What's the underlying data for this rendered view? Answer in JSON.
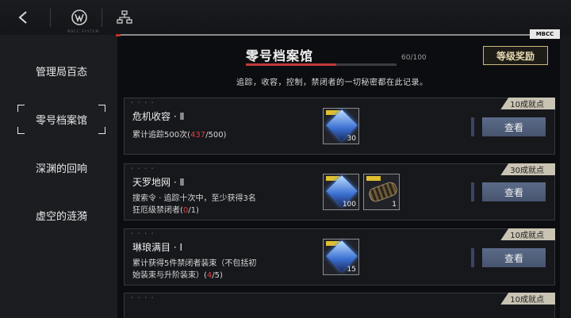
{
  "header": {
    "brand": "MBCC SYSTEM",
    "tag": "MBCC"
  },
  "sidebar": {
    "items": [
      {
        "label": "管理局百态"
      },
      {
        "label": "零号档案馆"
      },
      {
        "label": "深渊的回响"
      },
      {
        "label": "虚空的涟漪"
      }
    ]
  },
  "main": {
    "title": "零号档案馆",
    "progress_text": "60/100",
    "progress": 0.6,
    "subtitle": "追踪，收容，控制，禁闭者的一切秘密都在此记录。",
    "reward_button": "等级奖励",
    "cards": [
      {
        "title": "危机收容 · Ⅱ",
        "desc_a": "累计追踪500次(",
        "desc_cur": "437",
        "desc_b": "/500)",
        "badge": "10成就点",
        "button": "查看",
        "items": [
          {
            "qty": "30"
          }
        ]
      },
      {
        "title": "天罗地网 · Ⅱ",
        "desc_line1": "搜索令 · 追踪十次中，至少获得3名",
        "desc_a": "狂厄级禁闭者(",
        "desc_cur": "0",
        "desc_b": "/1)",
        "badge": "30成就点",
        "button": "查看",
        "items": [
          {
            "qty": "100"
          },
          {
            "qty": "1"
          }
        ]
      },
      {
        "title": "琳琅满目 · Ⅰ",
        "desc_line1": "累计获得5件禁闭者装束（不包括初",
        "desc_a": "始装束与升阶装束）(",
        "desc_cur": "4",
        "desc_b": "/5)",
        "badge": "10成就点",
        "button": "查看",
        "items": [
          {
            "qty": "15"
          }
        ]
      },
      {
        "badge": "10成就点"
      }
    ]
  },
  "colors": {
    "accent_red": "#c23a3a",
    "gold": "#cdb77a",
    "button_blue": "#5b6b88"
  }
}
